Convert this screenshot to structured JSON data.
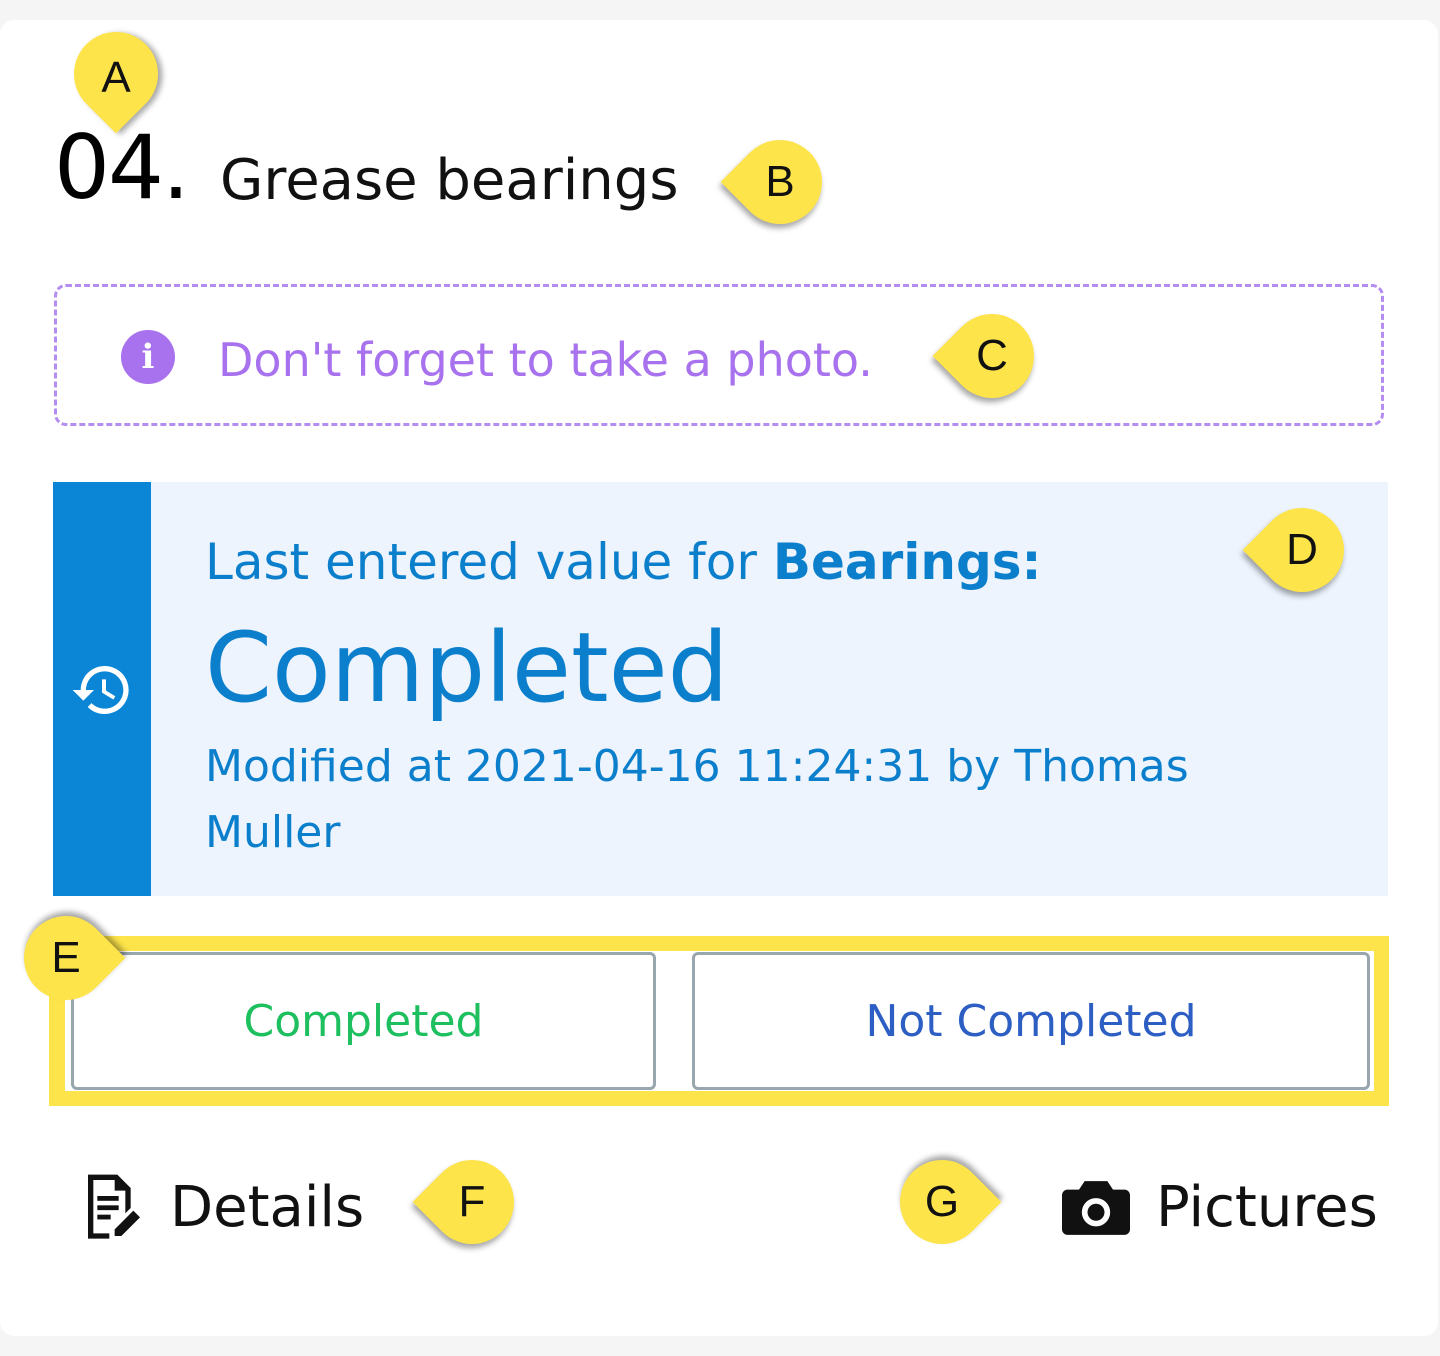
{
  "step": {
    "number": "04.",
    "title": "Grease bearings"
  },
  "hint": {
    "text": "Don't forget to take a photo."
  },
  "last_value": {
    "prefix": "Last entered value for ",
    "field": "Bearings:",
    "value": "Completed",
    "meta": "Modified at 2021-04-16 11:24:31 by Thomas Muller"
  },
  "choices": [
    {
      "label": "Completed"
    },
    {
      "label": "Not Completed"
    }
  ],
  "footer": {
    "details_label": "Details",
    "pictures_label": "Pictures"
  },
  "callouts": [
    "A",
    "B",
    "C",
    "D",
    "E",
    "F",
    "G"
  ],
  "colors": {
    "accent_purple": "#a872ee",
    "accent_blue": "#0b86d6",
    "completed_green": "#1dbf5e",
    "not_completed_blue": "#2d5ec3",
    "callout_yellow": "#fde44a"
  }
}
